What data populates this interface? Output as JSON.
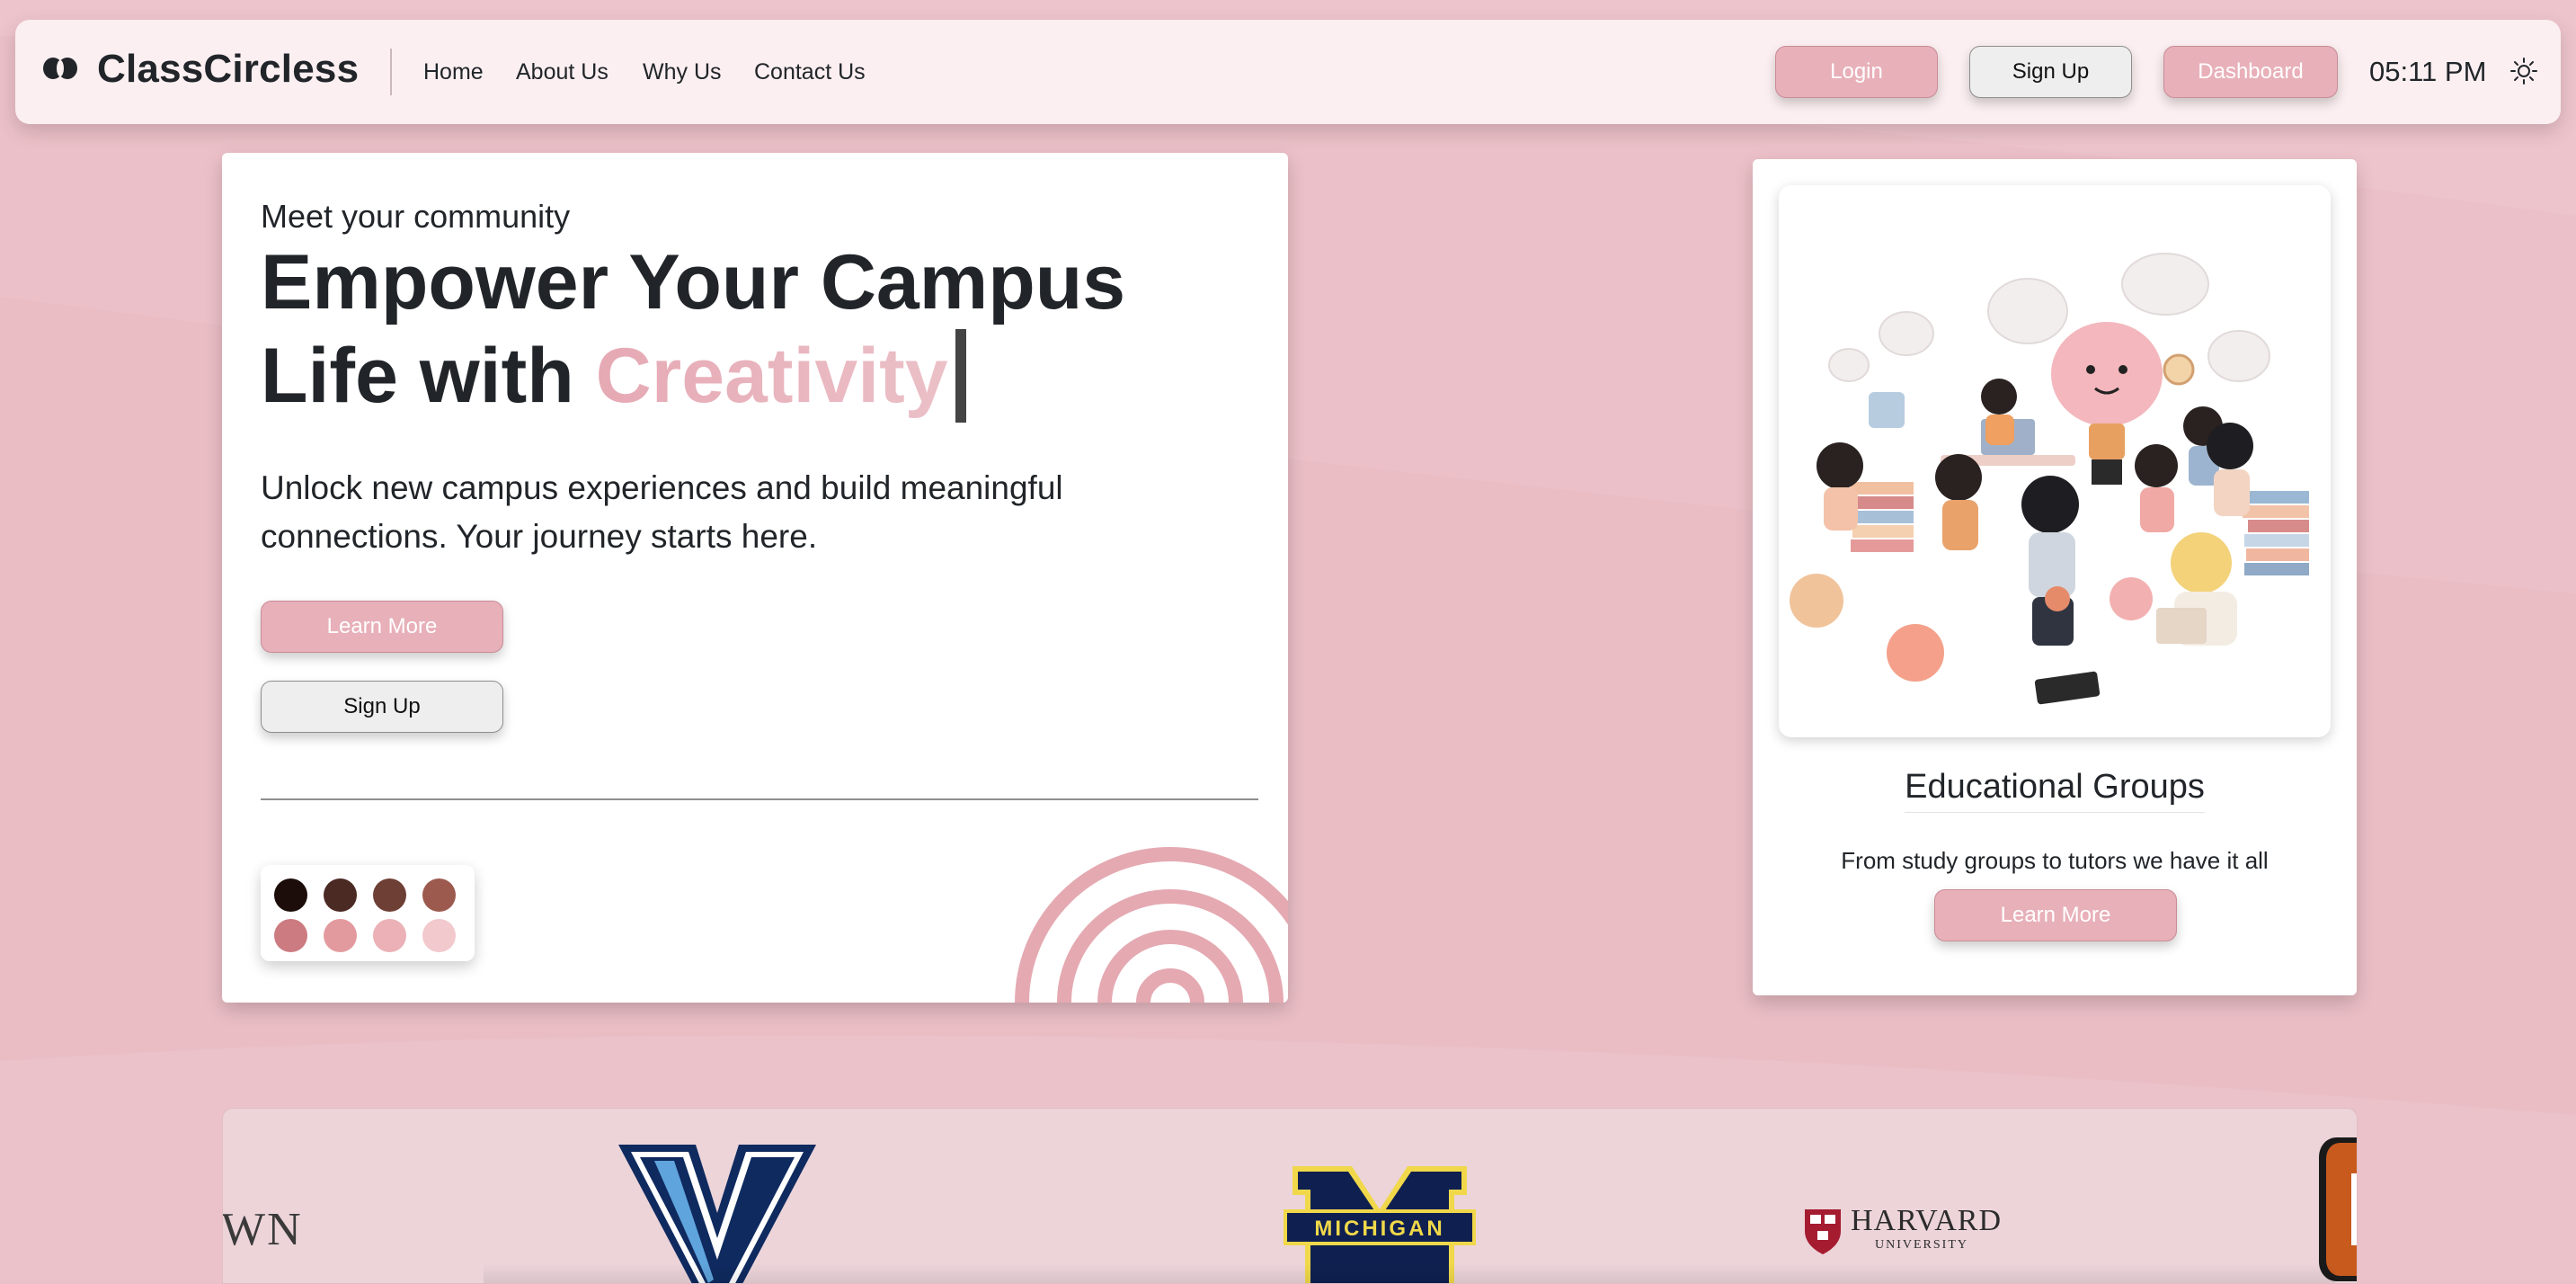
{
  "navbar": {
    "brand": "ClassCircless",
    "links": [
      "Home",
      "About Us",
      "Why Us",
      "Contact Us"
    ],
    "login_label": "Login",
    "signup_label": "Sign Up",
    "dashboard_label": "Dashboard",
    "clock": "05:11 PM",
    "theme_icon": "sun-icon"
  },
  "hero": {
    "eyebrow": "Meet your community",
    "headline_line1": "Empower Your Campus",
    "headline_line2_prefix": "Life with ",
    "headline_accent": "Creativity",
    "lead": "Unlock new campus experiences and build meaningful connections. Your journey starts here.",
    "learn_more_label": "Learn More",
    "signup_label": "Sign Up",
    "palette": [
      "#1c0d0a",
      "#4a2a23",
      "#6e3f35",
      "#9c5a4f",
      "#cc7b80",
      "#e39a9f",
      "#ebb1b6",
      "#f2c9cd"
    ]
  },
  "feature": {
    "title": "Educational Groups",
    "description": "From study groups to tutors we have it all",
    "learn_more_label": "Learn More"
  },
  "logos": {
    "partial_left_text": "WN",
    "villanova_letter": "V",
    "michigan_text": "MICHIGAN",
    "harvard_text": "HARVARD",
    "harvard_sub": "UNIVERSITY"
  },
  "colors": {
    "page_bg": "#ecc0c8",
    "accent_pink": "#e8b0b9",
    "navbar_bg": "#fbeff1",
    "strip_bg": "#ecd4d9"
  }
}
